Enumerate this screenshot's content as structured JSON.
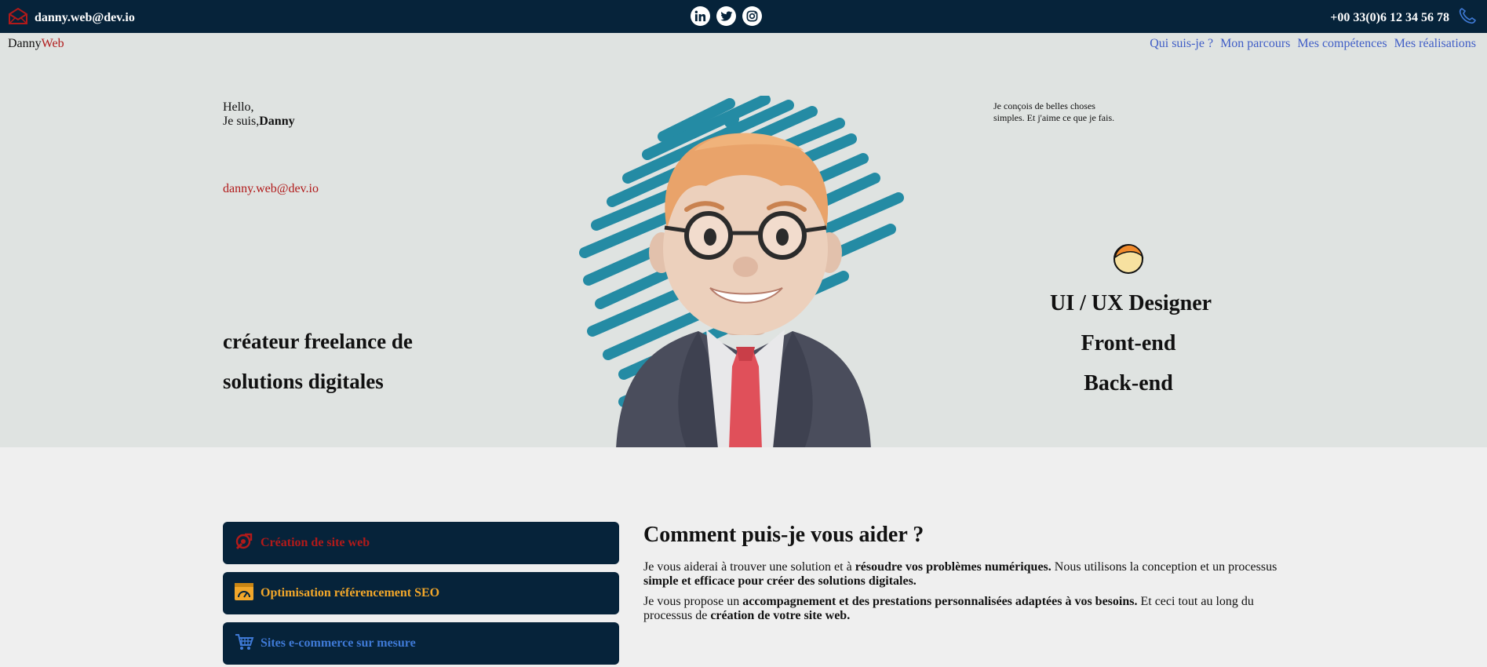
{
  "topbar": {
    "email": "danny.web@dev.io",
    "phone": "+00 33(0)6 12 34 56 78"
  },
  "brand": {
    "part1": "Danny",
    "part2": "Web"
  },
  "nav": {
    "items": [
      "Qui suis-je ?",
      "Mon parcours",
      "Mes compétences",
      "Mes réalisations"
    ]
  },
  "hero": {
    "hello": "Hello,",
    "intro_prefix": "Je suis,",
    "name": "Danny",
    "email": "danny.web@dev.io",
    "tagline_line1": "créateur freelance de",
    "tagline_line2": "solutions digitales",
    "intro_line1": "Je conçois de belles choses",
    "intro_line2": "simples. Et j'aime ce que je fais.",
    "roles": [
      "UI / UX Designer",
      "Front-end",
      "Back-end"
    ]
  },
  "services": [
    {
      "label": "Création de site web",
      "color": "#b11a1a",
      "icon": "web-design-icon"
    },
    {
      "label": "Optimisation référencement SEO",
      "color": "#f2a72a",
      "icon": "seo-gauge-icon"
    },
    {
      "label": "Sites e-commerce sur mesure",
      "color": "#3f7ad6",
      "icon": "shopping-cart-icon"
    }
  ],
  "help": {
    "title": "Comment puis-je vous aider ?",
    "p1_a": "Je vous aiderai à trouver une solution et à ",
    "p1_b": "résoudre vos problèmes numériques.",
    "p1_c": " Nous utilisons la conception et un processus ",
    "p1_d": "simple et efficace pour créer des solutions digitales.",
    "p2_a": "Je vous propose un ",
    "p2_b": "accompagnement et des prestations personnalisées adaptées à vos besoins.",
    "p2_c": " Et ceci tout au long du processus de ",
    "p2_d": "création de votre site web."
  },
  "colors": {
    "navy": "#06233a",
    "accent_red": "#b11a1a",
    "link_blue": "#3f5dc6",
    "hero_bg": "#dfe3e1",
    "page_bg": "#efefef"
  }
}
